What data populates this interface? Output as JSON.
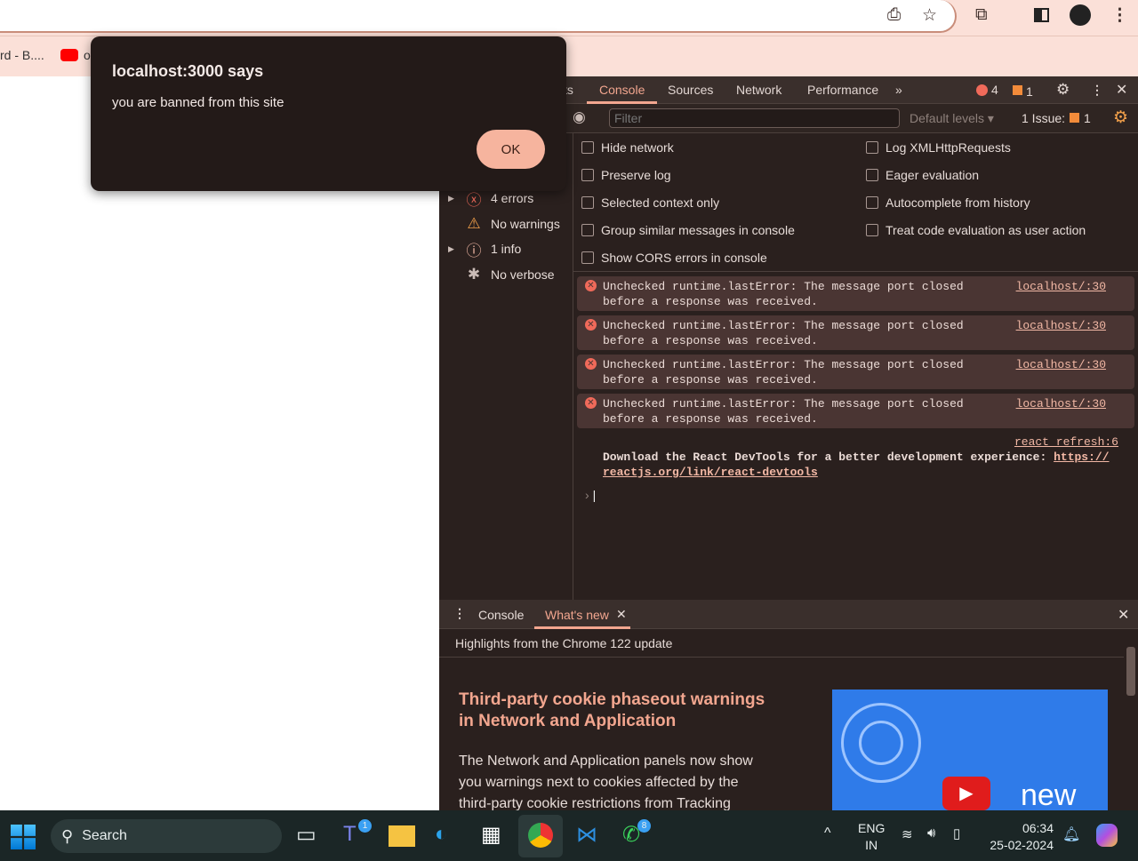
{
  "browser": {
    "bookmark_partial": "rd - B....",
    "bookmark2_partial": "o"
  },
  "dialog": {
    "title": "localhost:3000 says",
    "message": "you are banned from this site",
    "ok_label": "OK"
  },
  "devtools": {
    "tabs": [
      "ts",
      "Console",
      "Sources",
      "Network",
      "Performance"
    ],
    "active_tab": "Console",
    "error_count": "4",
    "issue_count": "1",
    "filter_placeholder": "Filter",
    "levels_label": "Default levels ▾",
    "issues_label": "1 Issue:",
    "issues_num": "1",
    "sidebar": [
      {
        "label": "4 errors",
        "icon": "error-icon"
      },
      {
        "label": "No warnings",
        "icon": "warning-icon"
      },
      {
        "label": "1 info",
        "icon": "info-icon"
      },
      {
        "label": "No verbose",
        "icon": "bug-icon"
      }
    ],
    "options_left": [
      "Hide network",
      "Preserve log",
      "Selected context only",
      "Group similar messages in console",
      "Show CORS errors in console"
    ],
    "options_right": [
      "Log XMLHttpRequests",
      "Eager evaluation",
      "Autocomplete from history",
      "Treat code evaluation as user action"
    ],
    "messages": [
      {
        "line1": "Unchecked runtime.lastError: The message port closed",
        "line2": "before a response was received.",
        "source": "localhost/:30"
      },
      {
        "line1": "Unchecked runtime.lastError: The message port closed",
        "line2": "before a response was received.",
        "source": "localhost/:30"
      },
      {
        "line1": "Unchecked runtime.lastError: The message port closed",
        "line2": "before a response was received.",
        "source": "localhost/:30"
      },
      {
        "line1": "Unchecked runtime.lastError: The message port closed",
        "line2": "before a response was received.",
        "source": "localhost/:30"
      }
    ],
    "react_msg": {
      "source": "react refresh:6",
      "text": "Download the React DevTools for a better development experience: ",
      "link1": "https://",
      "link2": "reactjs.org/link/react-devtools"
    },
    "drawer": {
      "tabs": [
        "Console",
        "What's new"
      ],
      "highlights": "Highlights from the Chrome 122 update",
      "heading1": "Third-party cookie phaseout warnings",
      "heading2": "in Network and Application",
      "body": [
        "The Network and Application panels now show",
        "you warnings next to cookies affected by the",
        "third-party cookie restrictions from Tracking"
      ],
      "video_label": "new"
    }
  },
  "taskbar": {
    "search": "Search",
    "teams_badge": "1",
    "whatsapp_badge": "8",
    "lang1": "ENG",
    "lang2": "IN",
    "time": "06:34",
    "date": "25-02-2024"
  },
  "colors": {
    "accent": "#f2a68f",
    "error": "#f06a5a",
    "chrome_bg": "#fbe0d8"
  }
}
